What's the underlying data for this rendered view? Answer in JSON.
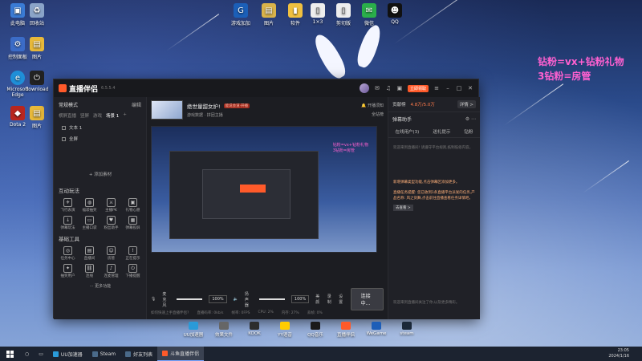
{
  "overlay": {
    "line1": "钻粉=vx+钻粉礼物",
    "line2": "3钻粉=房管"
  },
  "desktop_icons": [
    {
      "label": "此电脑",
      "icon": "computer-icon",
      "color": "#3a7bd5"
    },
    {
      "label": "回收站",
      "icon": "recycle-bin-icon",
      "color": "#8aa4c8"
    },
    {
      "label": "控制面板",
      "icon": "control-panel-icon",
      "color": "#3b6cc7"
    },
    {
      "label": "图片",
      "icon": "picture-icon",
      "color": "#e8b93a"
    },
    {
      "label": "Microsoft Edge",
      "icon": "edge-icon",
      "color": "#1f8fd8"
    },
    {
      "label": "download",
      "icon": "download-icon",
      "color": "#222222"
    },
    {
      "label": "Dota 2",
      "icon": "dota-icon",
      "color": "#b8261e"
    },
    {
      "label": "图片",
      "icon": "picture-icon",
      "color": "#e8b93a"
    },
    {
      "label": "游戏加加",
      "icon": "game-plus-icon",
      "color": "#1b5fb8"
    },
    {
      "label": "图片",
      "icon": "picture-icon",
      "color": "#d9b34a"
    },
    {
      "label": "软件",
      "icon": "folder-icon",
      "color": "#f0c040"
    },
    {
      "label": "1×3",
      "icon": "file-icon",
      "color": "#eeeeee"
    },
    {
      "label": "剪切版",
      "icon": "file-icon",
      "color": "#eeeeee"
    },
    {
      "label": "微信",
      "icon": "wechat-icon",
      "color": "#2aae4a"
    },
    {
      "label": "QQ",
      "icon": "qq-icon",
      "color": "#111111"
    }
  ],
  "app": {
    "logo": "直播伴侣",
    "version": "6.5.5.4",
    "promo": "立即领取",
    "mode": "常规模式",
    "edit": "编辑",
    "scene_tabs": [
      "横屏直播",
      "竖屏",
      "游戏",
      "场景 1"
    ],
    "sources": [
      "文本 1",
      "全屏"
    ],
    "add_source": "+ 添加素材",
    "tools_title": "互动玩法",
    "tools": [
      "飞行表演",
      "福袋抽奖",
      "主播PK",
      "礼物心愿",
      "弹幕玩法",
      "主播口袋",
      "粉丝助手",
      "弹幕投屏"
    ],
    "basic_title": "基础工具",
    "basic": [
      "任务中心",
      "直播间",
      "房管",
      "正在提示",
      "抽奖用户",
      "连线",
      "连麦管理",
      "下播提醒"
    ],
    "more_fn": "··· 更多功能",
    "room_title": "绝世量甜女护!",
    "room_tag": "能说会道·开播",
    "room_sub": "游戏数据 · 拼团主播",
    "room_right_top": "开播须知",
    "room_right_bottom": "全站榜",
    "preview_text": "钻粉=vx+钻粉礼物\n3钻粉=房管",
    "mic_label": "麦克风",
    "mic_pct": "100%",
    "speaker_label": "扬声器",
    "speaker_pct": "100%",
    "btn_effect": "美颜",
    "btn_record": "录制",
    "btn_settings": "设置",
    "start_btn": "连接中...",
    "status": [
      "如何快速上手直播伴侣?",
      "直播码率: 0kb/s",
      "帧率: 0FPS",
      "CPU: 2%",
      "内存: 27%",
      "丢帧: 0%"
    ],
    "right": {
      "fans_label": "贡献榜",
      "fans_count": "4.8万/5.0万",
      "rank_btn": "详情 >",
      "helper": "弹幕助手",
      "tabs": [
        "在线用户(3)",
        "送礼提示",
        "钻粉"
      ],
      "messages": [
        "欢迎来到直播间! 请遵守平台规则,抵制低俗内容。",
        "新增弹幕类型功能,点击弹幕区添加更多。",
        "直播任务提醒: 您已收到1条直播平台派发的任务,产品名称: 风之剑舞,点击前往直播查看任务详情吧。",
        "欢迎来到直播间关注了你,以及更多精彩。"
      ],
      "more_btn": "去查看 >"
    }
  },
  "dock": [
    "UU加速器",
    "效果文件",
    "KOOK",
    "YY语音",
    "WeGame",
    "steam",
    "QQ音乐",
    "直播伴侣"
  ],
  "taskbar": {
    "items": [
      "UU加速器",
      "Steam",
      "好友列表",
      "斗鱼直播伴侣"
    ],
    "time": "23:05",
    "date": "2024/1/16"
  }
}
